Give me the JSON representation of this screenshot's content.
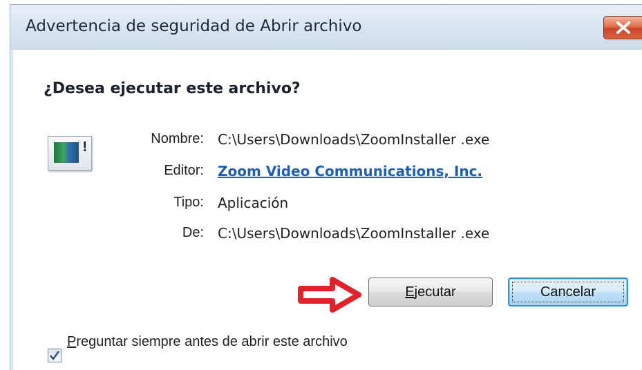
{
  "dialog": {
    "title": "Advertencia de seguridad de Abrir archivo",
    "close_glyph": "✕"
  },
  "content": {
    "heading": "¿Desea ejecutar este archivo?",
    "icon": "application-exe-icon",
    "fields": {
      "name_label": "Nombre:",
      "name_value": "C:\\Users\\Downloads\\ZoomInstaller .exe",
      "publisher_label": "Editor:",
      "publisher_value": "Zoom Video Communications, Inc.",
      "type_label": "Tipo:",
      "type_value": "Aplicación",
      "from_label": "De:",
      "from_value": "C:\\Users\\Downloads\\ZoomInstaller .exe"
    }
  },
  "buttons": {
    "run_mnemonic": "E",
    "run_rest": "jecutar",
    "cancel": "Cancelar"
  },
  "checkbox": {
    "checked": true,
    "label_mnemonic": "P",
    "label_rest": "reguntar siempre antes de abrir este archivo"
  },
  "annotation": {
    "arrow_color": "#e0232b"
  },
  "colors": {
    "link": "#1f5fb8",
    "close_button": "#d9633e",
    "focus_border": "#2d8fd6"
  }
}
